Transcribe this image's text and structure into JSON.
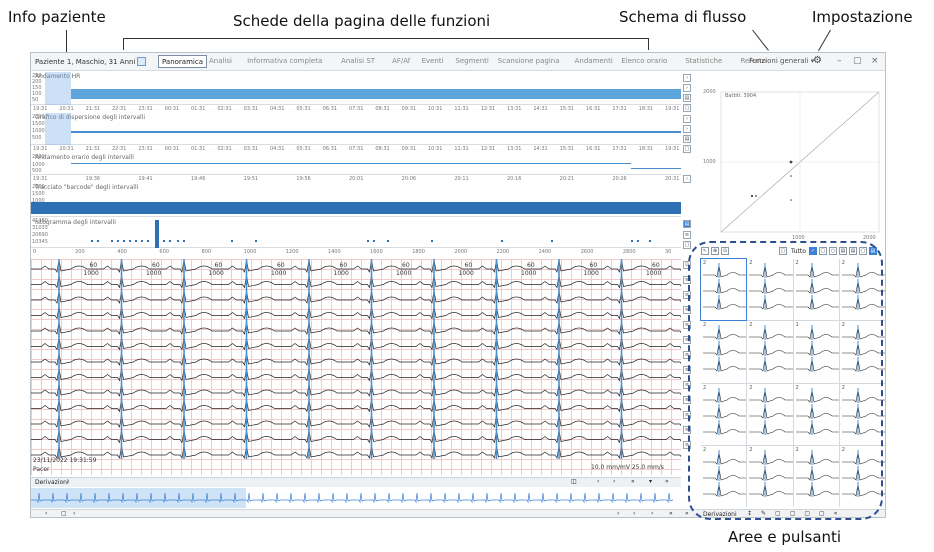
{
  "callouts": {
    "patient_info": "Info paziente",
    "tabs": "Schede della pagina delle funzioni",
    "flow": "Schema di flusso",
    "settings": "Impostazione",
    "areas": "Aree e pulsanti"
  },
  "header": {
    "patient": "Paziente 1,  Maschio,  31 Anni",
    "tabs": [
      "Panoramica",
      "Analisi",
      "Informativa completa",
      "Analisi ST",
      "AF/Af",
      "Eventi",
      "Segmenti",
      "Scansione pagina",
      "Andamenti",
      "Elenco orario",
      "Statistiche",
      "Referto"
    ],
    "active_tab": "Panoramica",
    "flow_select": "Funzioni generali ▾",
    "gear_icon": "gear-icon",
    "window_controls": [
      "–",
      "▢",
      "×"
    ]
  },
  "trends": {
    "hr_label": "Andamento HR",
    "hr_y": [
      "250",
      "200",
      "150",
      "100",
      "50"
    ],
    "scatter_label": "Grafico di dispersione degli intervalli",
    "scatter_y": [
      "2000",
      "1500",
      "1000",
      "500"
    ],
    "rr_label": "Andamento orario degli intervalli",
    "rr_y": [
      "2000",
      "1500",
      "1000",
      "500"
    ],
    "barcode_label": "Tracciato \"barcode\" degli intervalli",
    "barcode_y": [
      "2000",
      "1500",
      "1000",
      "500"
    ],
    "histo_label": "Istogramma degli intervalli",
    "histo_y": [
      "41380",
      "31035",
      "20690",
      "10345"
    ],
    "time_ticks": [
      "19:31",
      "20:31",
      "21:31",
      "22:31",
      "23:31",
      "00:31",
      "01:31",
      "02:31",
      "03:31",
      "04:31",
      "05:31",
      "06:31",
      "07:31",
      "08:31",
      "09:31",
      "10:31",
      "11:31",
      "12:31",
      "13:31",
      "14:31",
      "15:31",
      "16:31",
      "17:31",
      "18:31",
      "19:31"
    ],
    "zoom_ticks": [
      "19:31",
      "19:36",
      "19:41",
      "19:46",
      "19:51",
      "19:56",
      "20:01",
      "20:06",
      "20:11",
      "20:16",
      "20:21",
      "20:26",
      "20:31"
    ],
    "histo_ticks": [
      "0",
      "200",
      "400",
      "600",
      "800",
      "1000",
      "1200",
      "1400",
      "1600",
      "1800",
      "2000",
      "2200",
      "2400",
      "2600",
      "2800",
      "30"
    ]
  },
  "ecg": {
    "rr_label": "60",
    "rr_ms": "1000",
    "datetime": "23/11/2022 19:31:59",
    "mode": "Pacer",
    "scale": "10.0 mm/mV 25.0 mm/s"
  },
  "bottom": {
    "derivations": "Derivazioni",
    "panel_derivations": "Derivazioni"
  },
  "scatter": {
    "title": "Battiti: 3904",
    "y_ticks": [
      "2000",
      "1000"
    ],
    "x_ticks": [
      "1000",
      "2000"
    ]
  },
  "panel": {
    "filter": "Tutto",
    "cell_numbers": [
      "2",
      "2",
      "2",
      "2",
      "2",
      "2",
      "1",
      "2",
      "2",
      "2",
      "2",
      "2",
      "2",
      "2",
      "2",
      "2"
    ]
  }
}
